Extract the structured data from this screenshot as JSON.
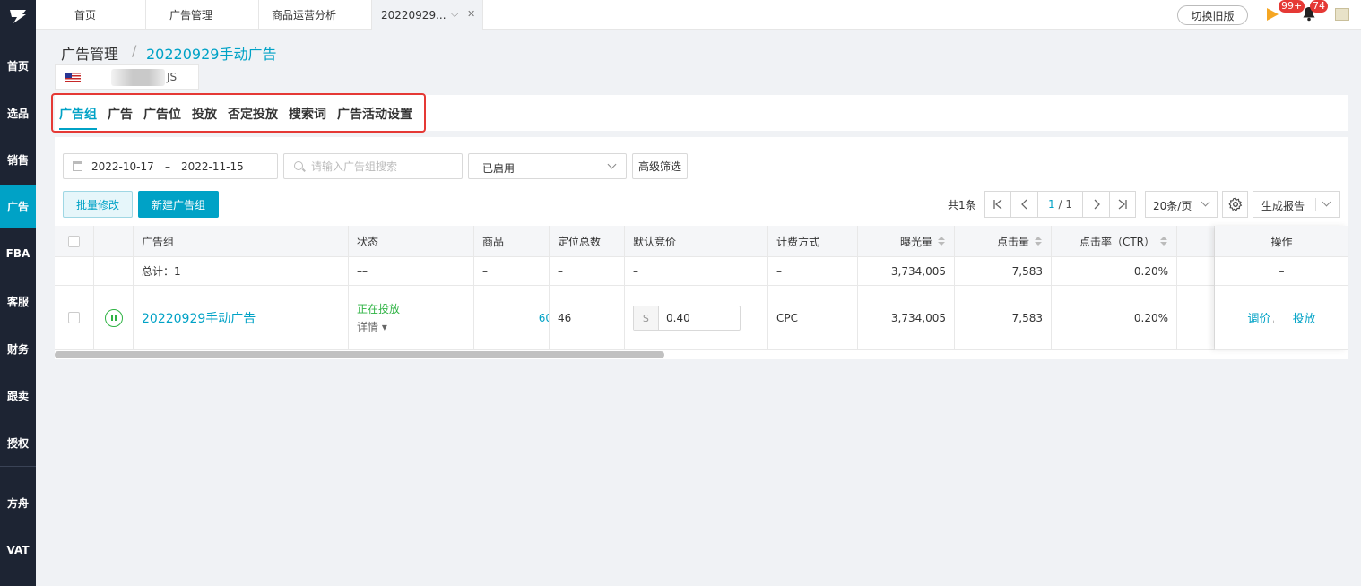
{
  "sidebar": {
    "items": [
      "首页",
      "选品",
      "销售",
      "广告",
      "FBA",
      "客服",
      "财务",
      "跟卖",
      "授权",
      "方舟",
      "VAT"
    ]
  },
  "topbar": {
    "tabs": [
      "首页",
      "广告管理",
      "商品运营分析",
      "20220929..."
    ],
    "switch_label": "切换旧版",
    "badge_flag": "99+",
    "badge_bell": "74"
  },
  "breadcrumb": {
    "root": "广告管理",
    "sep": "/",
    "current": "20220929手动广告"
  },
  "shop": {
    "name": "JS"
  },
  "sub_tabs": [
    "广告组",
    "广告",
    "广告位",
    "投放",
    "否定投放",
    "搜索词",
    "广告活动设置"
  ],
  "filters": {
    "date_start": "2022-10-17",
    "date_sep": "–",
    "date_end": "2022-11-15",
    "search_placeholder": "请输入广告组搜索",
    "status_value": "已启用",
    "advanced_label": "高级筛选"
  },
  "actions": {
    "batch_edit": "批量修改",
    "new_group": "新建广告组"
  },
  "pagination": {
    "total": "共1条",
    "current": "1",
    "of": "/ 1",
    "page_size": "20条/页",
    "report": "生成报告"
  },
  "table": {
    "headers": [
      "广告组",
      "状态",
      "商品",
      "定位总数",
      "默认竞价",
      "计费方式",
      "曝光量",
      "点击量",
      "点击率（CTR）",
      "操作"
    ],
    "summary": {
      "name": "总计：1",
      "status": "––",
      "product": "–",
      "targets": "–",
      "bid": "–",
      "billing": "–",
      "impressions": "3,734,005",
      "clicks": "7,583",
      "ctr": "0.20%",
      "ops": "–"
    },
    "row": {
      "name": "20220929手动广告",
      "status": "正在投放",
      "detail": "详情",
      "product": "60",
      "targets": "46",
      "bid_prefix": "$",
      "bid": "0.40",
      "billing": "CPC",
      "impressions": "3,734,005",
      "clicks": "7,583",
      "ctr": "0.20%",
      "op_adjust": "调价",
      "op_target": "投放"
    }
  },
  "colors": {
    "accent": "#00a2c6",
    "sidebar": "#1d2433",
    "active_status": "#2fb344",
    "highlight": "#e53935"
  }
}
